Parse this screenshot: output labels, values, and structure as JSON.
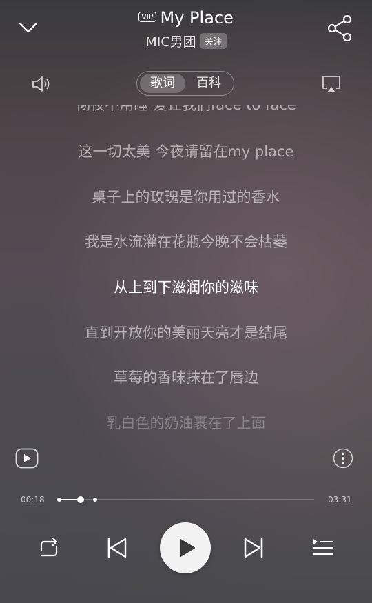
{
  "header": {
    "vip_badge": "VIP",
    "song_title": "My Place",
    "artist": "MIC男团",
    "follow_label": "关注"
  },
  "tabs": [
    {
      "label": "歌词",
      "selected": true
    },
    {
      "label": "百科",
      "selected": false
    }
  ],
  "lyrics": [
    {
      "text": "彻夜不用睡 爱让我们face to face",
      "state": "partial"
    },
    {
      "text": "这一切太美 今夜请留在my place",
      "state": "normal"
    },
    {
      "text": "桌子上的玫瑰是你用过的香水",
      "state": "normal"
    },
    {
      "text": "我是水流灌在花瓶今晚不会枯萎",
      "state": "normal"
    },
    {
      "text": "从上到下滋润你的滋味",
      "state": "current"
    },
    {
      "text": "直到开放你的美丽天亮才是结尾",
      "state": "normal"
    },
    {
      "text": "草莓的香味抹在了唇边",
      "state": "normal"
    },
    {
      "text": "乳白色的奶油裹在了上面",
      "state": "faded"
    }
  ],
  "playback": {
    "elapsed": "00:18",
    "duration": "03:31",
    "progress_fraction": 0.085
  },
  "icons": {
    "collapse": "chevron-down-icon",
    "share": "share-icon",
    "volume": "volume-icon",
    "cast": "cast-icon",
    "video": "video-play-icon",
    "more": "more-vertical-icon",
    "repeat": "repeat-icon",
    "prev": "skip-previous-icon",
    "play": "play-icon",
    "next": "skip-next-icon",
    "playlist": "playlist-icon"
  }
}
